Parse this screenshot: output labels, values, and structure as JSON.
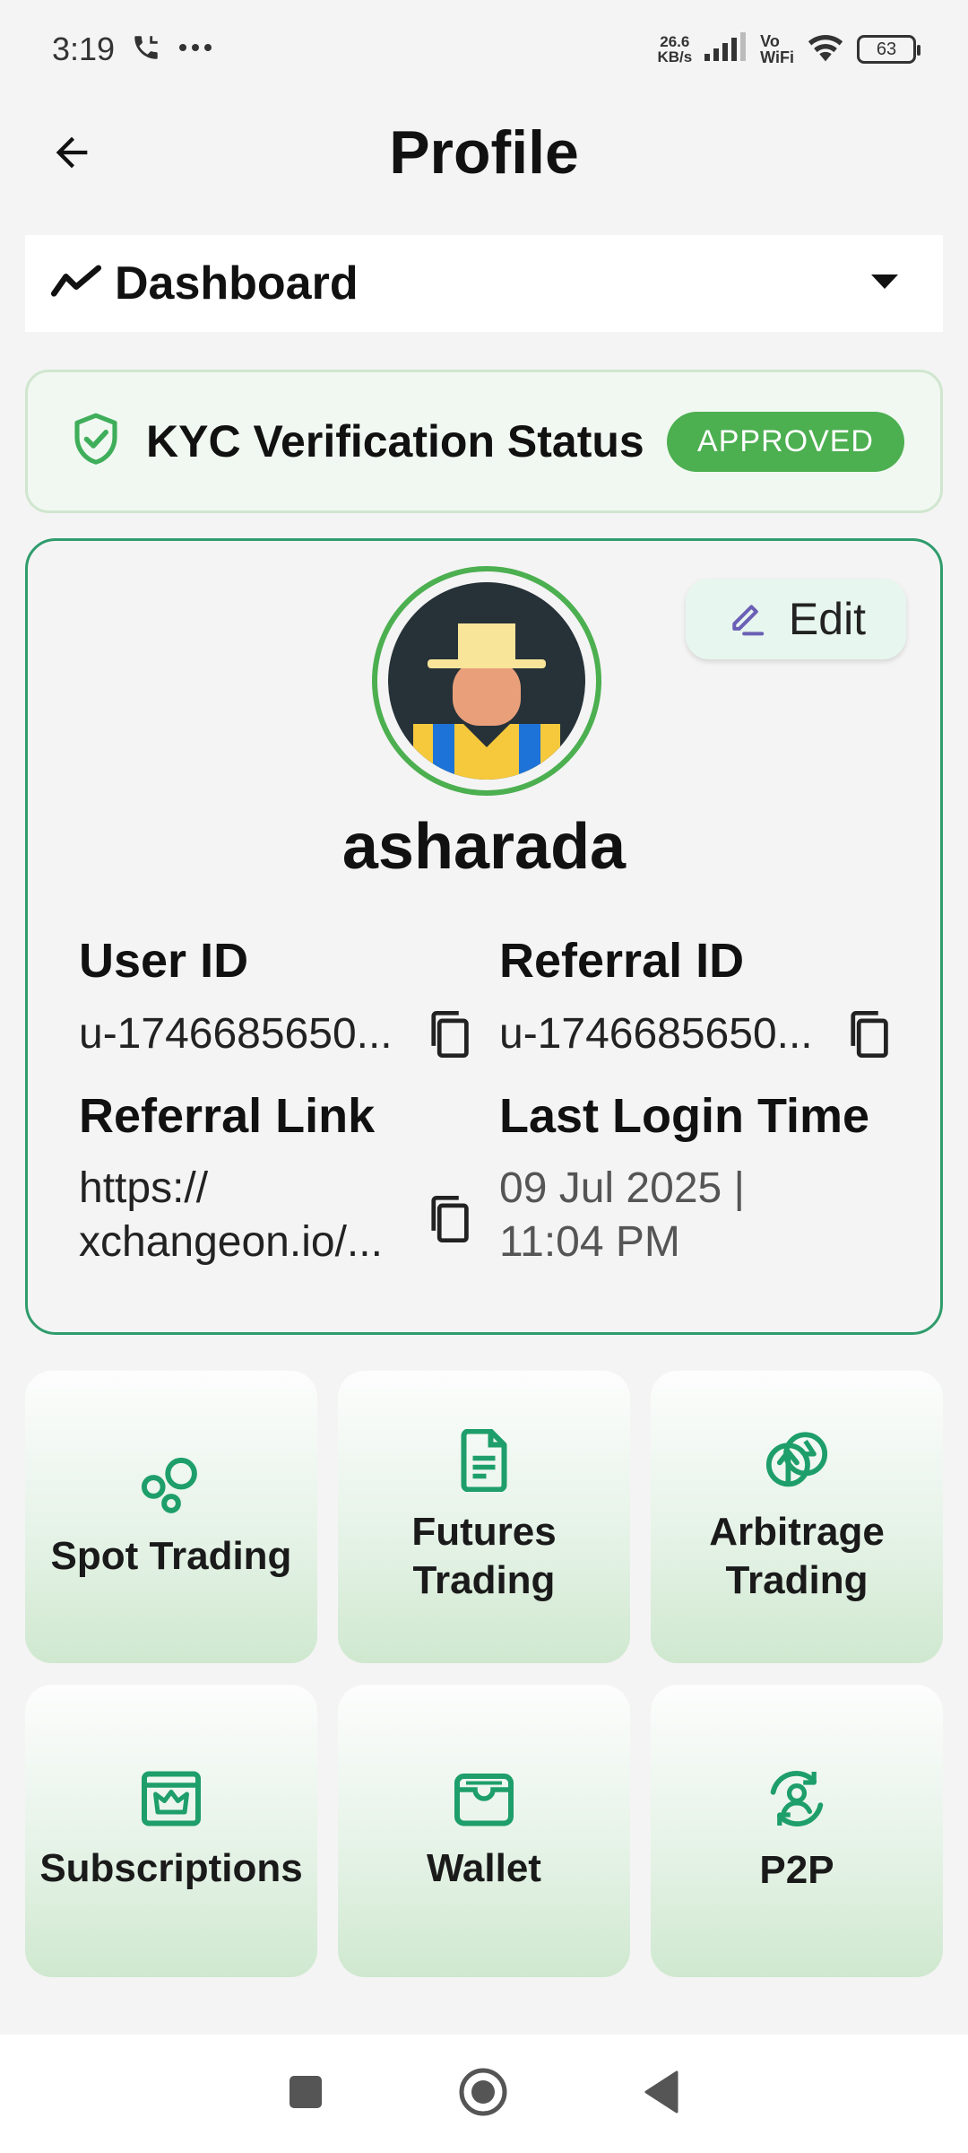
{
  "status_bar": {
    "time": "3:19",
    "net_speed_value": "26.6",
    "net_speed_unit": "KB/s",
    "volte_top": "Vo",
    "volte_bottom": "WiFi",
    "battery": "63"
  },
  "header": {
    "title": "Profile"
  },
  "dashboard_select": {
    "label": "Dashboard"
  },
  "kyc": {
    "label": "KYC Verification Status",
    "status": "APPROVED",
    "status_color": "#4caf50"
  },
  "profile": {
    "edit_label": "Edit",
    "username": "asharada",
    "user_id_label": "User ID",
    "user_id_value": "u-1746685650...",
    "referral_id_label": "Referral ID",
    "referral_id_value": "u-1746685650...",
    "referral_link_label": "Referral Link",
    "referral_link_line1": "https://",
    "referral_link_line2": "xchangeon.io/...",
    "last_login_label": "Last Login Time",
    "last_login_line1": "09 Jul 2025 |",
    "last_login_line2": "11:04 PM"
  },
  "tiles": [
    {
      "label": "Spot Trading",
      "icon": "bubbles-icon"
    },
    {
      "label_line1": "Futures",
      "label_line2": "Trading",
      "icon": "document-icon"
    },
    {
      "label_line1": "Arbitrage",
      "label_line2": "Trading",
      "icon": "swap-coin-icon"
    },
    {
      "label": "Subscriptions",
      "icon": "crown-icon"
    },
    {
      "label": "Wallet",
      "icon": "wallet-icon"
    },
    {
      "label": "P2P",
      "icon": "p2p-exchange-icon"
    }
  ],
  "colors": {
    "accent_green": "#1e9e6a",
    "card_border": "#2f9c6c"
  }
}
